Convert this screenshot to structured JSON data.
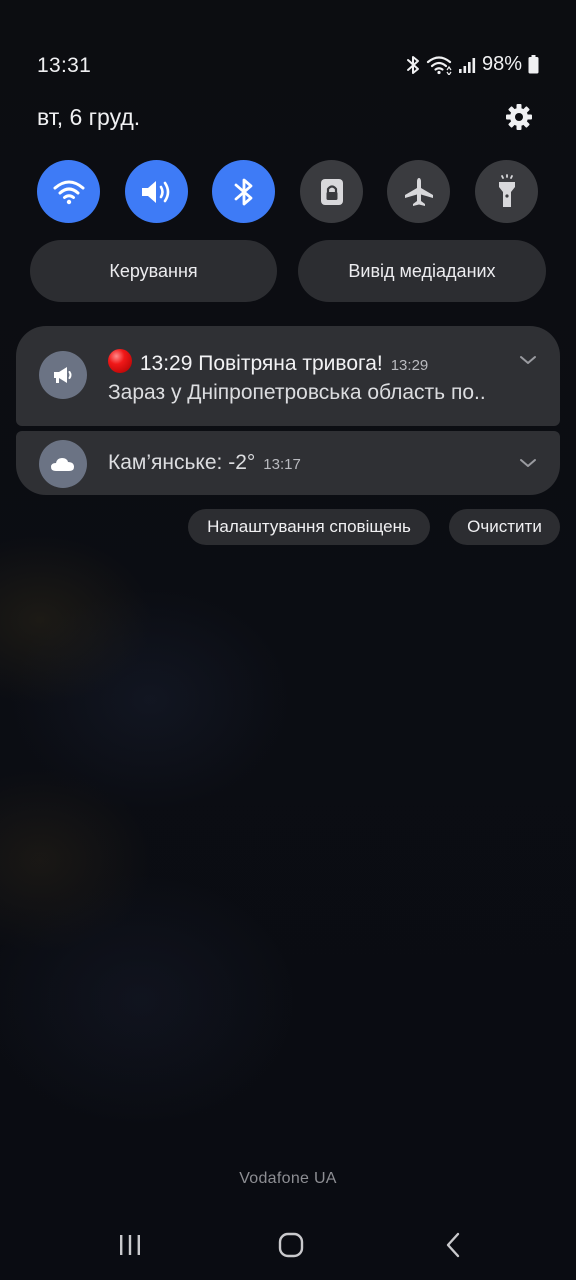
{
  "status_bar": {
    "time": "13:31",
    "battery_percent": "98%",
    "icons": [
      "bluetooth-icon",
      "wifi-icon",
      "signal-icon",
      "battery-icon"
    ]
  },
  "header": {
    "date": "вт, 6 груд."
  },
  "quick_toggles": [
    {
      "name": "wifi",
      "icon": "wifi-icon",
      "state": "on"
    },
    {
      "name": "sound",
      "icon": "sound-icon",
      "state": "on"
    },
    {
      "name": "bluetooth",
      "icon": "bluetooth-icon",
      "state": "on"
    },
    {
      "name": "rotation-lock",
      "icon": "lock-icon",
      "state": "off"
    },
    {
      "name": "airplane-mode",
      "icon": "airplane-icon",
      "state": "off"
    },
    {
      "name": "flashlight",
      "icon": "flashlight-icon",
      "state": "off"
    }
  ],
  "panel_buttons": {
    "device_control": "Керування",
    "media_output": "Вивід медіаданих"
  },
  "notifications": [
    {
      "icon": "megaphone-icon",
      "title": "13:29 Повітряна тривога!",
      "time": "13:29",
      "body": "Зараз у Дніпропетровська область по.."
    },
    {
      "icon": "cloud-icon",
      "title": "Кам’янське: -2°",
      "time": "13:17"
    }
  ],
  "notification_actions": {
    "settings": "Налаштування сповіщень",
    "clear": "Очистити"
  },
  "carrier": "Vodafone UA",
  "colors": {
    "toggle_on": "#3e7bf6",
    "toggle_off": "#3a3b3f",
    "card": "#2f3034",
    "background": "#0b0d12"
  }
}
